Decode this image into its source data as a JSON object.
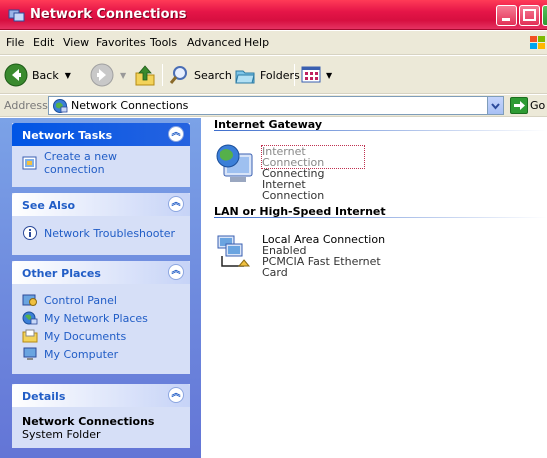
{
  "window": {
    "title": "Network Connections"
  },
  "menu": [
    "File",
    "Edit",
    "View",
    "Favorites",
    "Tools",
    "Advanced",
    "Help"
  ],
  "toolbar": {
    "back": "Back",
    "search": "Search",
    "folders": "Folders"
  },
  "address": {
    "label": "Address",
    "value": "Network Connections",
    "go": "Go"
  },
  "left_panel": {
    "network_tasks": {
      "title": "Network Tasks",
      "items": [
        "Create a new connection"
      ]
    },
    "see_also": {
      "title": "See Also",
      "items": [
        "Network Troubleshooter"
      ]
    },
    "other_places": {
      "title": "Other Places",
      "items": [
        "Control Panel",
        "My Network Places",
        "My Documents",
        "My Computer"
      ]
    },
    "details": {
      "title": "Details",
      "name": "Network Connections",
      "sub": "System Folder"
    }
  },
  "content": {
    "groups": [
      {
        "title": "Internet Gateway",
        "items": [
          {
            "name": "Internet Connection",
            "status": "Connecting",
            "device": "Internet Connection"
          }
        ]
      },
      {
        "title": "LAN or High-Speed Internet",
        "items": [
          {
            "name": "Local Area Connection",
            "status": "Enabled",
            "device": "PCMCIA Fast Ethernet Card"
          }
        ]
      }
    ]
  },
  "icons": {
    "title": "network-connections-icon",
    "back": "back-arrow-icon",
    "forward": "forward-arrow-icon",
    "up": "folder-up-icon",
    "search": "search-icon",
    "folders": "folders-icon",
    "views": "views-icon",
    "go": "go-arrow-icon"
  },
  "colors": {
    "titlebar": "#e51548",
    "task_link": "#215dc6",
    "panel": "#6f8fe0"
  }
}
